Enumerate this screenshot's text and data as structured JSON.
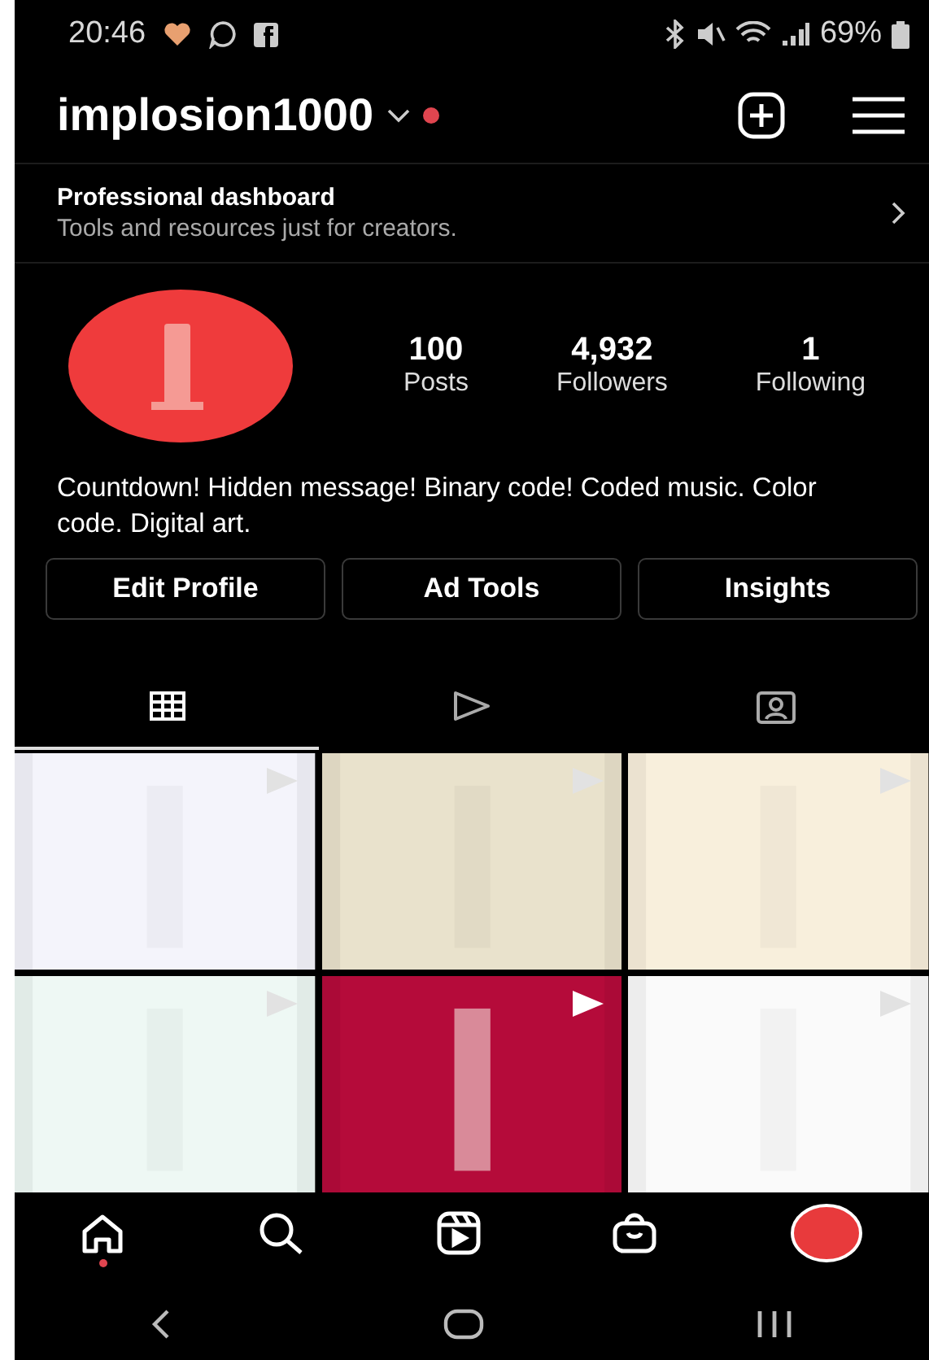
{
  "status_bar": {
    "time": "20:46",
    "battery": "69%"
  },
  "header": {
    "username": "implosion1000",
    "has_notification": true
  },
  "dashboard": {
    "title": "Professional dashboard",
    "subtitle": "Tools and resources just for creators."
  },
  "stats": [
    {
      "value": "100",
      "label": "Posts"
    },
    {
      "value": "4,932",
      "label": "Followers"
    },
    {
      "value": "1",
      "label": "Following"
    }
  ],
  "bio": "Countdown! Hidden message! Binary code! Coded music. Color code. Digital art.",
  "buttons": [
    "Edit Profile",
    "Ad Tools",
    "Insights"
  ],
  "tabs": [
    {
      "kind": "grid",
      "selected": true
    },
    {
      "kind": "reels",
      "selected": false
    },
    {
      "kind": "tagged",
      "selected": false
    }
  ],
  "posts": [
    {
      "kind": "picture",
      "video": true
    },
    {
      "kind": "picture",
      "video": true
    },
    {
      "kind": "picture",
      "video": true
    },
    {
      "kind": "picture",
      "video": true
    },
    {
      "kind": "picture",
      "video": true
    },
    {
      "kind": "picture",
      "video": true
    }
  ],
  "bottom_nav": [
    {
      "kind": "home",
      "selected": true
    },
    {
      "kind": "search",
      "selected": false
    },
    {
      "kind": "reels",
      "selected": false
    },
    {
      "kind": "shop",
      "selected": false
    },
    {
      "kind": "profile",
      "selected": false
    }
  ],
  "system_nav": [
    {
      "kind": "back"
    },
    {
      "kind": "home"
    },
    {
      "kind": "recents"
    }
  ]
}
